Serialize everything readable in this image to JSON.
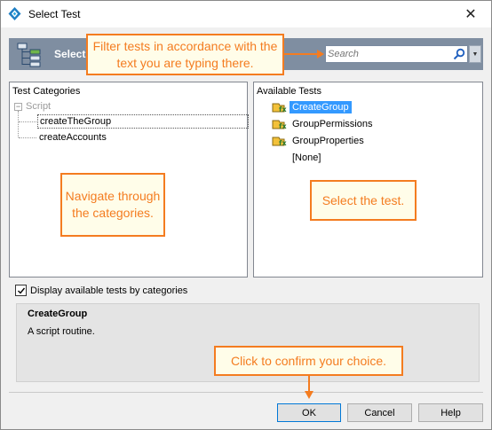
{
  "window": {
    "title": "Select Test",
    "close_glyph": "✕"
  },
  "banner": {
    "title": "Select"
  },
  "search": {
    "placeholder": "Search",
    "value": "",
    "dropdown_glyph": "▼"
  },
  "categories": {
    "header": "Test Categories",
    "root": {
      "label": "Script",
      "toggle": "−"
    },
    "children": [
      {
        "label": "createTheGroup",
        "selected": true
      },
      {
        "label": "createAccounts",
        "selected": false
      }
    ]
  },
  "tests": {
    "header": "Available Tests",
    "items": [
      {
        "label": "CreateGroup",
        "selected": true,
        "icon": "script-routine-icon"
      },
      {
        "label": "GroupPermissions",
        "selected": false,
        "icon": "script-routine-icon"
      },
      {
        "label": "GroupProperties",
        "selected": false,
        "icon": "script-routine-icon"
      },
      {
        "label": "[None]",
        "selected": false,
        "icon": ""
      }
    ]
  },
  "options": {
    "display_by_categories_label": "Display available tests by categories",
    "display_by_categories_checked": true
  },
  "description": {
    "title": "CreateGroup",
    "text": "A script routine."
  },
  "buttons": {
    "ok": "OK",
    "cancel": "Cancel",
    "help": "Help"
  },
  "callouts": {
    "filter": "Filter tests in accordance with the text you are typing there.",
    "navigate": "Navigate through the categories.",
    "select": "Select the test.",
    "confirm": "Click to confirm your choice."
  },
  "colors": {
    "accent": "#f47c20",
    "selection": "#3399ff",
    "banner": "#7f8ea1"
  }
}
